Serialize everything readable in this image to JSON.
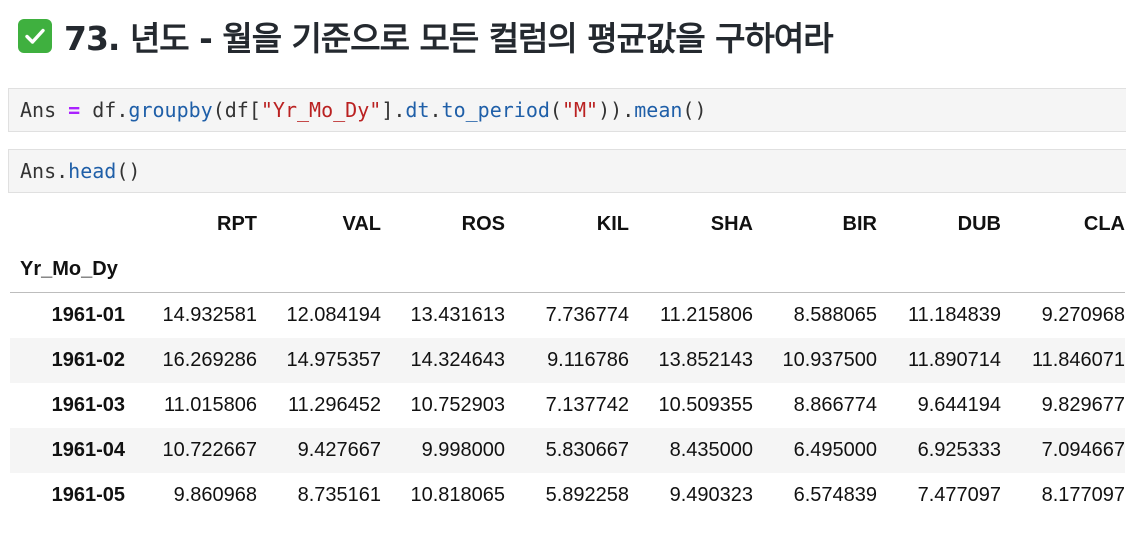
{
  "heading": {
    "icon": "check-mark-button-icon",
    "text": "73. 년도 - 월을 기준으로 모든 컬럼의 평균값을 구하여라"
  },
  "cells": [
    {
      "tokens": [
        "Ans",
        " ",
        "=",
        " ",
        "df",
        ".",
        "groupby",
        "(",
        "df",
        "[",
        "\"Yr_Mo_Dy\"",
        "].",
        "dt",
        ".",
        "to_period",
        "(",
        "\"M\"",
        "))",
        ".",
        "mean",
        "()"
      ]
    },
    {
      "tokens": [
        "Ans",
        ".",
        "head",
        "()"
      ]
    }
  ],
  "dataframe": {
    "columns": [
      "RPT",
      "VAL",
      "ROS",
      "KIL",
      "SHA",
      "BIR",
      "DUB",
      "CLA"
    ],
    "index_name": "Yr_Mo_Dy",
    "rows": [
      {
        "index": "1961-01",
        "values": [
          "14.932581",
          "12.084194",
          "13.431613",
          "7.736774",
          "11.215806",
          "8.588065",
          "11.184839",
          "9.270968"
        ]
      },
      {
        "index": "1961-02",
        "values": [
          "16.269286",
          "14.975357",
          "14.324643",
          "9.116786",
          "13.852143",
          "10.937500",
          "11.890714",
          "11.846071"
        ]
      },
      {
        "index": "1961-03",
        "values": [
          "11.015806",
          "11.296452",
          "10.752903",
          "7.137742",
          "10.509355",
          "8.866774",
          "9.644194",
          "9.829677"
        ]
      },
      {
        "index": "1961-04",
        "values": [
          "10.722667",
          "9.427667",
          "9.998000",
          "5.830667",
          "8.435000",
          "6.495000",
          "6.925333",
          "7.094667"
        ]
      },
      {
        "index": "1961-05",
        "values": [
          "9.860968",
          "8.735161",
          "10.818065",
          "5.892258",
          "9.490323",
          "6.574839",
          "7.477097",
          "8.177097"
        ]
      }
    ]
  }
}
